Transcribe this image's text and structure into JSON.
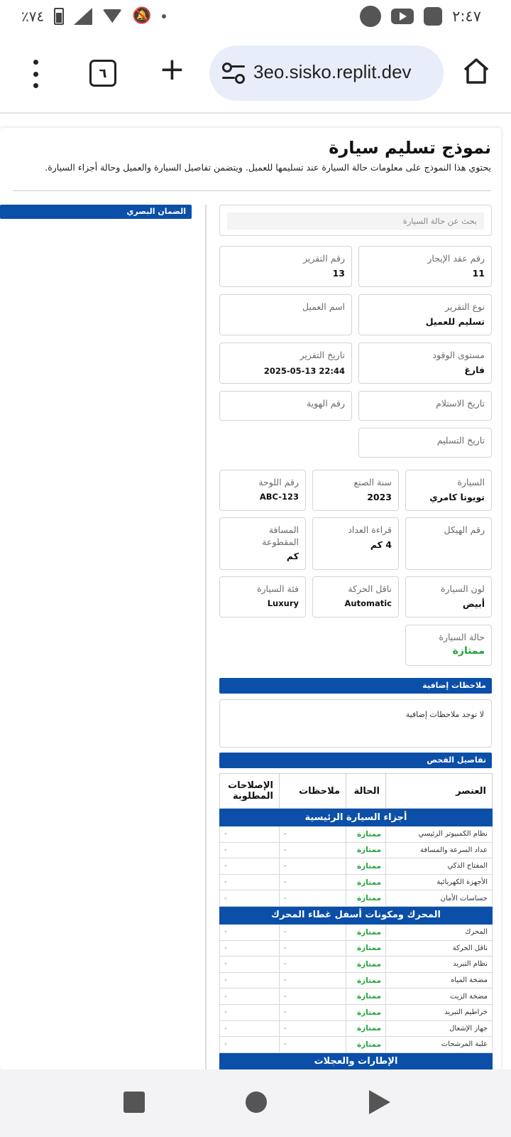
{
  "status_bar": {
    "time": "٢:٤٧",
    "battery": "٪٧٤"
  },
  "browser": {
    "url": "3eo.sisko.replit.dev",
    "tab_count": "٦"
  },
  "form": {
    "title": "نموذج تسليم سيارة",
    "subtitle": "يحتوي هذا النموذج على معلومات حالة السيارة عند تسليمها للعميل. ويتضمن تفاصيل السيارة والعميل وحالة أجزاء السيارة.",
    "side_banner": "الضمان البصري",
    "search_placeholder": "بحث عن حالة السيارة",
    "fields": {
      "lease_no": {
        "label": "رقم عقد الإيجار",
        "value": "11"
      },
      "report_no": {
        "label": "رقم التقرير",
        "value": "13"
      },
      "report_type": {
        "label": "نوع التقرير",
        "value": "تسليم للعميل"
      },
      "customer_name": {
        "label": "اسم العميل",
        "value": ""
      },
      "fuel_level": {
        "label": "مستوى الوقود",
        "value": "فارغ"
      },
      "report_date": {
        "label": "تاريخ التقرير",
        "value": "2025-05-13 22:44"
      },
      "receive_date": {
        "label": "تاريخ الاستلام",
        "value": ""
      },
      "id_no": {
        "label": "رقم الهوية",
        "value": ""
      },
      "delivery_date": {
        "label": "تاريخ التسليم",
        "value": ""
      },
      "car": {
        "label": "السيارة",
        "value": "تويوتا كامري"
      },
      "year": {
        "label": "سنة الصنع",
        "value": "2023"
      },
      "plate": {
        "label": "رقم اللوحة",
        "value": "ABC-123"
      },
      "chassis": {
        "label": "رقم الهيكل",
        "value": ""
      },
      "odometer": {
        "label": "قراءة العداد",
        "value": "4 كم"
      },
      "distance": {
        "label": "المسافة المقطوعة",
        "value": "كم"
      },
      "color": {
        "label": "لون السيارة",
        "value": "أبيض"
      },
      "transmission": {
        "label": "ناقل الحركة",
        "value": "Automatic"
      },
      "category": {
        "label": "فئة السيارة",
        "value": "Luxury"
      },
      "condition": {
        "label": "حالة السيارة",
        "value": "ممتازة"
      }
    },
    "notes_header": "ملاحظات إضافية",
    "notes_text": "لا توجد ملاحظات إضافية",
    "inspection_header": "تفاصيل الفحص",
    "table": {
      "headers": {
        "item": "العنصر",
        "status": "الحالة",
        "notes": "ملاحظات",
        "repairs": "الإصلاحات المطلوبة"
      },
      "groups": [
        {
          "title": "أجزاء السيارة الرئيسية",
          "rows": [
            {
              "item": "نظام الكمبيوتر الرئيسي",
              "status": "ممتازة",
              "notes": "-",
              "repairs": "-"
            },
            {
              "item": "عداد السرعة والمسافة",
              "status": "ممتازة",
              "notes": "-",
              "repairs": "-"
            },
            {
              "item": "المفتاح الذكي",
              "status": "ممتازة",
              "notes": "-",
              "repairs": "-"
            },
            {
              "item": "الأجهزة الكهربائية",
              "status": "ممتازة",
              "notes": "-",
              "repairs": "-"
            },
            {
              "item": "حساسات الأمان",
              "status": "ممتازة",
              "notes": "-",
              "repairs": "-"
            }
          ]
        },
        {
          "title": "المحرك ومكونات أسفل غطاء المحرك",
          "rows": [
            {
              "item": "المحرك",
              "status": "ممتازة",
              "notes": "-",
              "repairs": "-"
            },
            {
              "item": "ناقل الحركة",
              "status": "ممتازة",
              "notes": "-",
              "repairs": "-"
            },
            {
              "item": "نظام التبريد",
              "status": "ممتازة",
              "notes": "-",
              "repairs": "-"
            },
            {
              "item": "مضخة المياه",
              "status": "ممتازة",
              "notes": "-",
              "repairs": "-"
            },
            {
              "item": "مضخة الزيت",
              "status": "ممتازة",
              "notes": "-",
              "repairs": "-"
            },
            {
              "item": "خراطيم التبريد",
              "status": "ممتازة",
              "notes": "-",
              "repairs": "-"
            },
            {
              "item": "جهاز الإشعال",
              "status": "ممتازة",
              "notes": "-",
              "repairs": "-"
            },
            {
              "item": "علبة المرشحات",
              "status": "ممتازة",
              "notes": "-",
              "repairs": "-"
            }
          ]
        },
        {
          "title": "الإطارات والعجلات",
          "rows": []
        }
      ]
    }
  },
  "colors": {
    "accent": "#0b4fa8",
    "good": "#22a33a"
  }
}
